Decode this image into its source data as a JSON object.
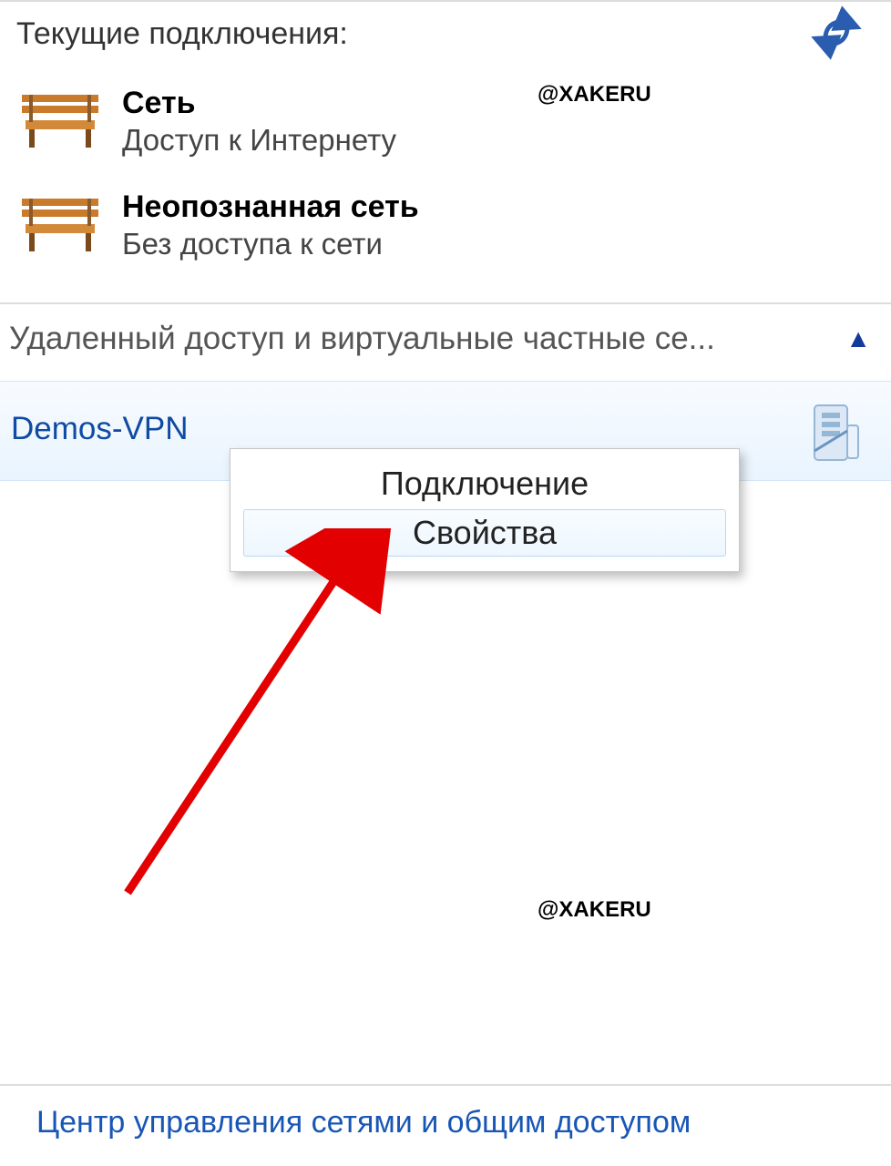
{
  "header": {
    "title": "Текущие подключения:"
  },
  "watermark": "@XAKERU",
  "networks": [
    {
      "name": "Сеть",
      "status": "Доступ к Интернету"
    },
    {
      "name": "Неопознанная сеть",
      "status": "Без доступа к сети"
    }
  ],
  "section": {
    "label": "Удаленный доступ и виртуальные частные се..."
  },
  "vpn": {
    "name": "Demos-VPN"
  },
  "context_menu": {
    "items": [
      {
        "label": "Подключение",
        "highlighted": false
      },
      {
        "label": "Свойства",
        "highlighted": true
      }
    ]
  },
  "footer": {
    "link": "Центр управления сетями и общим доступом"
  },
  "colors": {
    "link": "#1856b5",
    "accent": "#2a5db0"
  }
}
